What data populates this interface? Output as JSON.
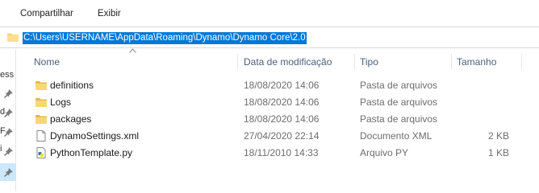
{
  "ribbon": {
    "tabs": [
      "Compartilhar",
      "Exibir"
    ]
  },
  "address": {
    "path": "C:\\Users\\USERNAME\\AppData\\Roaming\\Dynamo\\Dynamo Core\\2.0"
  },
  "nav_pane": {
    "partial_labels": [
      "ess",
      "d",
      "F",
      "i"
    ]
  },
  "columns": {
    "name": "Nome",
    "date": "Data de modificação",
    "type": "Tipo",
    "size": "Tamanho"
  },
  "files": [
    {
      "name": "definitions",
      "date": "18/08/2020 14:06",
      "type": "Pasta de arquivos",
      "size": "",
      "icon": "folder-icon"
    },
    {
      "name": "Logs",
      "date": "18/08/2020 14:06",
      "type": "Pasta de arquivos",
      "size": "",
      "icon": "folder-icon"
    },
    {
      "name": "packages",
      "date": "18/08/2020 14:06",
      "type": "Pasta de arquivos",
      "size": "",
      "icon": "folder-icon"
    },
    {
      "name": "DynamoSettings.xml",
      "date": "27/04/2020 22:14",
      "type": "Documento XML",
      "size": "2 KB",
      "icon": "xml-file-icon"
    },
    {
      "name": "PythonTemplate.py",
      "date": "18/11/2010 14:33",
      "type": "Arquivo PY",
      "size": "1 KB",
      "icon": "python-file-icon"
    }
  ],
  "colors": {
    "selection": "#0078d7",
    "folder": "#f8d775",
    "header_text": "#4c607a",
    "pin_selected": "#cce8ff"
  }
}
